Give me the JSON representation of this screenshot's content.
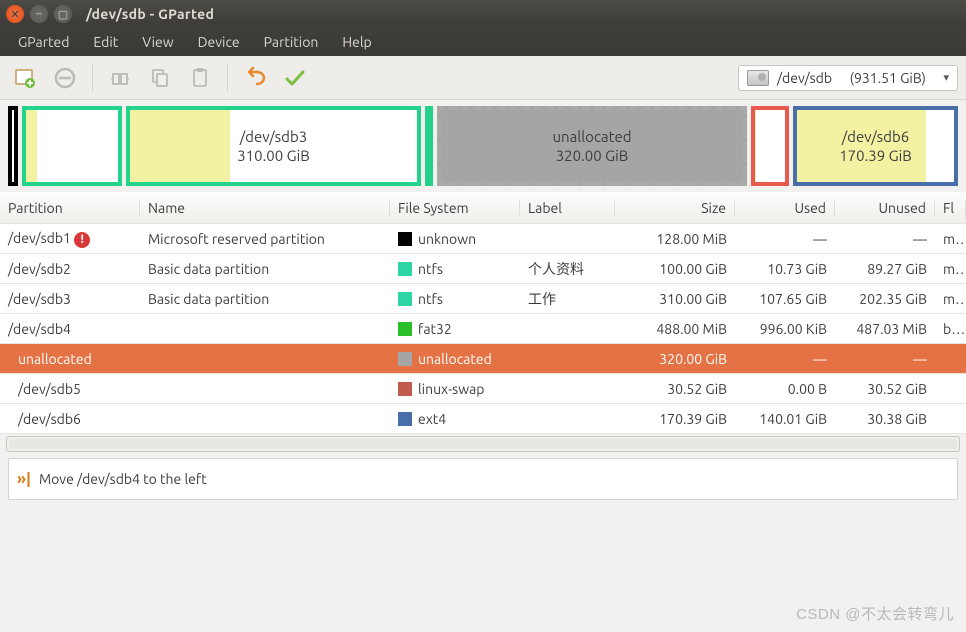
{
  "window": {
    "title": "/dev/sdb - GParted"
  },
  "menubar": [
    "GParted",
    "Edit",
    "View",
    "Device",
    "Partition",
    "Help"
  ],
  "device_selector": {
    "device": "/dev/sdb",
    "size": "(931.51 GiB)"
  },
  "viz": {
    "sdb3": {
      "label": "/dev/sdb3",
      "size": "310.00 GiB"
    },
    "unallocated": {
      "label": "unallocated",
      "size": "320.00 GiB"
    },
    "sdb6": {
      "label": "/dev/sdb6",
      "size": "170.39 GiB"
    }
  },
  "columns": {
    "partition": "Partition",
    "name": "Name",
    "fs": "File System",
    "label": "Label",
    "size": "Size",
    "used": "Used",
    "unused": "Unused",
    "flags": "Fl"
  },
  "rows": [
    {
      "partition": "/dev/sdb1",
      "warn": true,
      "name": "Microsoft reserved partition",
      "fs": "unknown",
      "fs_color": "#000000",
      "label": "",
      "size": "128.00 MiB",
      "used": "—",
      "unused": "—",
      "flags": "msf"
    },
    {
      "partition": "/dev/sdb2",
      "name": "Basic data partition",
      "fs": "ntfs",
      "fs_color": "#2fd6a3",
      "label": "个人资料",
      "size": "100.00 GiB",
      "used": "10.73 GiB",
      "unused": "89.27 GiB",
      "flags": "msf"
    },
    {
      "partition": "/dev/sdb3",
      "name": "Basic data partition",
      "fs": "ntfs",
      "fs_color": "#2fd6a3",
      "label": "工作",
      "size": "310.00 GiB",
      "used": "107.65 GiB",
      "unused": "202.35 GiB",
      "flags": "msf"
    },
    {
      "partition": "/dev/sdb4",
      "name": "",
      "fs": "fat32",
      "fs_color": "#2bbf2b",
      "label": "",
      "size": "488.00 MiB",
      "used": "996.00 KiB",
      "unused": "487.03 MiB",
      "flags": "boo"
    },
    {
      "partition": "unallocated",
      "selected": true,
      "indent": true,
      "name": "",
      "fs": "unallocated",
      "fs_color": "#a5a5a5",
      "label": "",
      "size": "320.00 GiB",
      "used": "—",
      "unused": "—",
      "flags": ""
    },
    {
      "partition": "/dev/sdb5",
      "indent": true,
      "name": "",
      "fs": "linux-swap",
      "fs_color": "#c15a4f",
      "label": "",
      "size": "30.52 GiB",
      "used": "0.00 B",
      "unused": "30.52 GiB",
      "flags": ""
    },
    {
      "partition": "/dev/sdb6",
      "indent": true,
      "name": "",
      "fs": "ext4",
      "fs_color": "#4a6ea8",
      "label": "",
      "size": "170.39 GiB",
      "used": "140.01 GiB",
      "unused": "30.38 GiB",
      "flags": ""
    }
  ],
  "pending": {
    "text": "Move /dev/sdb4 to the left"
  },
  "watermark": "CSDN @不太会转弯儿"
}
